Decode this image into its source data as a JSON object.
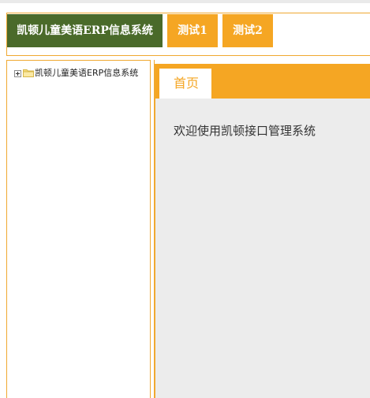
{
  "header": {
    "brand_label": "凯顿儿童美语ERP信息系统",
    "nav_items": [
      {
        "label": "测试1"
      },
      {
        "label": "测试2"
      }
    ]
  },
  "tree": {
    "root_label": "凯顿儿童美语ERP信息系统",
    "root_expanded": false
  },
  "main": {
    "tabs": [
      {
        "label": "首页",
        "active": true
      }
    ],
    "welcome_text": "欢迎使用凯顿接口管理系统"
  },
  "theme": {
    "accent": "#f5a623",
    "brand_bg": "#4a6a2a",
    "content_bg": "#ececec"
  }
}
